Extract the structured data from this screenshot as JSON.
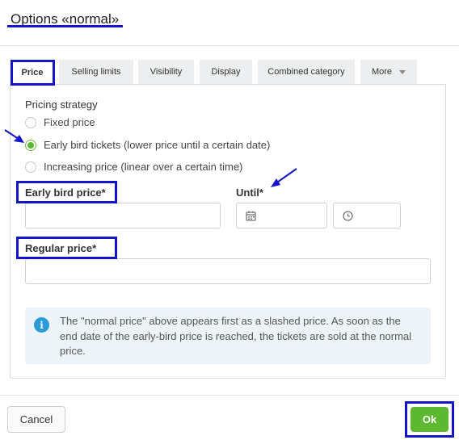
{
  "dialog": {
    "title": "Options «normal»"
  },
  "tabs": [
    {
      "label": "Price",
      "active": true
    },
    {
      "label": "Selling limits",
      "active": false
    },
    {
      "label": "Visibility",
      "active": false
    },
    {
      "label": "Display",
      "active": false
    },
    {
      "label": "Combined category",
      "active": false
    },
    {
      "label": "More",
      "active": false,
      "dropdown": true
    }
  ],
  "pricing": {
    "heading": "Pricing strategy",
    "options": [
      {
        "label": "Fixed price",
        "checked": false
      },
      {
        "label": "Early bird tickets (lower price until a certain date)",
        "checked": true
      },
      {
        "label": "Increasing price (linear over a certain time)",
        "checked": false
      }
    ]
  },
  "fields": {
    "early_bird_label": "Early bird price*",
    "early_bird_value": "",
    "until_label": "Until*",
    "until_date_value": "",
    "until_time_value": "",
    "regular_label": "Regular price*",
    "regular_value": ""
  },
  "info": {
    "text": "The \"normal price\" above appears first as a slashed price. As soon as the end date of the early-bird price is reached, the tickets are sold at the normal price.",
    "icon": "info-icon"
  },
  "footer": {
    "cancel_label": "Cancel",
    "ok_label": "Ok"
  },
  "colors": {
    "accent_green": "#5cb82e",
    "highlight_blue": "#1313c9",
    "info_blue": "#2a9bd8"
  }
}
